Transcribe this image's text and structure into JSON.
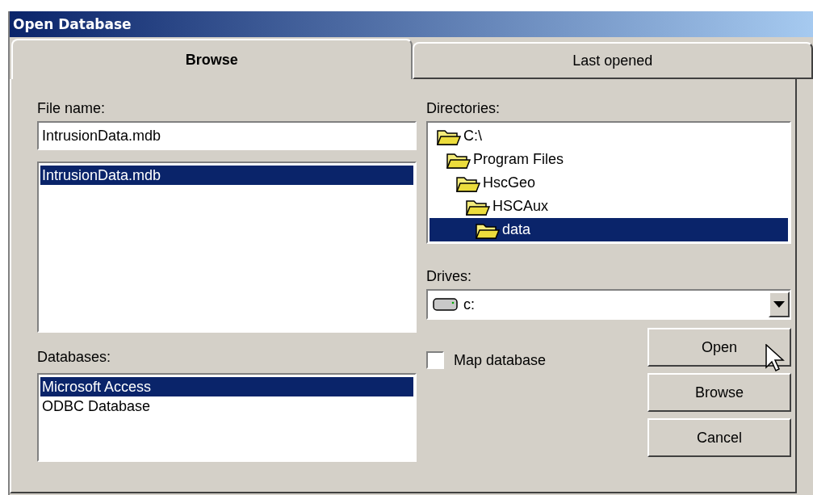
{
  "window": {
    "title": "Open Database"
  },
  "tabs": [
    {
      "label": "Browse",
      "selected": true
    },
    {
      "label": "Last opened",
      "selected": false
    }
  ],
  "file_name": {
    "label": "File name:",
    "value": "IntrusionData.mdb"
  },
  "files": [
    {
      "label": "IntrusionData.mdb",
      "selected": true
    }
  ],
  "databases_label": "Databases:",
  "databases": [
    {
      "label": "Microsoft Access",
      "selected": true
    },
    {
      "label": "ODBC Database",
      "selected": false
    }
  ],
  "directories_label": "Directories:",
  "directories": [
    {
      "label": "C:\\",
      "selected": false,
      "children": [
        {
          "label": "Program Files",
          "selected": false,
          "children": [
            {
              "label": "HscGeo",
              "selected": false,
              "children": [
                {
                  "label": "HSCAux",
                  "selected": false,
                  "children": [
                    {
                      "label": "data",
                      "selected": true
                    }
                  ]
                }
              ]
            }
          ]
        }
      ]
    }
  ],
  "drives": {
    "label": "Drives:",
    "value": "c:"
  },
  "map_database": {
    "label": "Map database",
    "checked": false
  },
  "buttons": [
    "Open",
    "Browse",
    "Cancel"
  ]
}
